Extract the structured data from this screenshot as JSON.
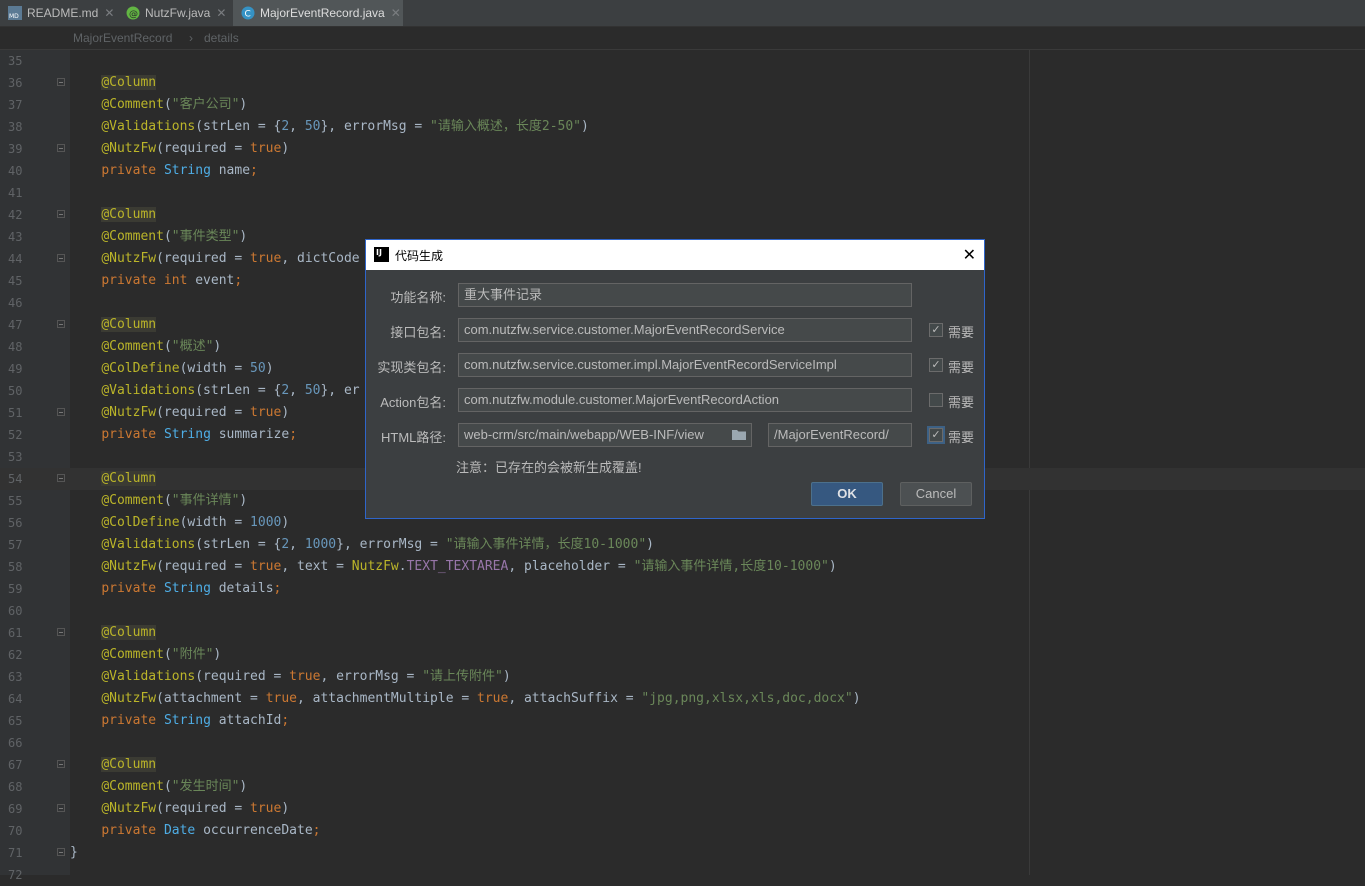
{
  "tabs": [
    {
      "label": "README.md",
      "icon": "markdown-file-icon",
      "active": false
    },
    {
      "label": "NutzFw.java",
      "icon": "annotation-file-icon",
      "active": false
    },
    {
      "label": "MajorEventRecord.java",
      "icon": "class-file-icon",
      "active": true
    }
  ],
  "breadcrumb": {
    "class_name": "MajorEventRecord",
    "member": "details"
  },
  "editor": {
    "lines": [
      {
        "n": "35",
        "fold": false,
        "tokens": []
      },
      {
        "n": "36",
        "fold": true,
        "tokens": [
          {
            "t": "    "
          },
          {
            "t": "@Column",
            "c": "ann hl"
          }
        ]
      },
      {
        "n": "37",
        "fold": false,
        "tokens": [
          {
            "t": "    "
          },
          {
            "t": "@Comment",
            "c": "ann"
          },
          {
            "t": "("
          },
          {
            "t": "\"客户公司\"",
            "c": "str"
          },
          {
            "t": ")"
          }
        ]
      },
      {
        "n": "38",
        "fold": false,
        "tokens": [
          {
            "t": "    "
          },
          {
            "t": "@Validations",
            "c": "ann"
          },
          {
            "t": "(strLen = {"
          },
          {
            "t": "2",
            "c": "num"
          },
          {
            "t": ", "
          },
          {
            "t": "50",
            "c": "num"
          },
          {
            "t": "}, errorMsg = "
          },
          {
            "t": "\"请输入概述，长度2-50\"",
            "c": "str"
          },
          {
            "t": ")"
          }
        ]
      },
      {
        "n": "39",
        "fold": true,
        "tokens": [
          {
            "t": "    "
          },
          {
            "t": "@NutzFw",
            "c": "ann"
          },
          {
            "t": "(required = "
          },
          {
            "t": "true",
            "c": "kw"
          },
          {
            "t": ")"
          }
        ]
      },
      {
        "n": "40",
        "fold": false,
        "tokens": [
          {
            "t": "    "
          },
          {
            "t": "private ",
            "c": "kw"
          },
          {
            "t": "String ",
            "c": "typ"
          },
          {
            "t": "name"
          },
          {
            "t": ";",
            "c": "kw"
          }
        ]
      },
      {
        "n": "41",
        "fold": false,
        "tokens": []
      },
      {
        "n": "42",
        "fold": true,
        "tokens": [
          {
            "t": "    "
          },
          {
            "t": "@Column",
            "c": "ann hl"
          }
        ]
      },
      {
        "n": "43",
        "fold": false,
        "tokens": [
          {
            "t": "    "
          },
          {
            "t": "@Comment",
            "c": "ann"
          },
          {
            "t": "("
          },
          {
            "t": "\"事件类型\"",
            "c": "str"
          },
          {
            "t": ")"
          }
        ]
      },
      {
        "n": "44",
        "fold": true,
        "tokens": [
          {
            "t": "    "
          },
          {
            "t": "@NutzFw",
            "c": "ann"
          },
          {
            "t": "(required = "
          },
          {
            "t": "true",
            "c": "kw"
          },
          {
            "t": ", dictCode"
          }
        ]
      },
      {
        "n": "45",
        "fold": false,
        "tokens": [
          {
            "t": "    "
          },
          {
            "t": "private int ",
            "c": "kw"
          },
          {
            "t": "event"
          },
          {
            "t": ";",
            "c": "kw"
          }
        ]
      },
      {
        "n": "46",
        "fold": false,
        "tokens": []
      },
      {
        "n": "47",
        "fold": true,
        "tokens": [
          {
            "t": "    "
          },
          {
            "t": "@Column",
            "c": "ann hl"
          }
        ]
      },
      {
        "n": "48",
        "fold": false,
        "tokens": [
          {
            "t": "    "
          },
          {
            "t": "@Comment",
            "c": "ann"
          },
          {
            "t": "("
          },
          {
            "t": "\"概述\"",
            "c": "str"
          },
          {
            "t": ")"
          }
        ]
      },
      {
        "n": "49",
        "fold": false,
        "tokens": [
          {
            "t": "    "
          },
          {
            "t": "@ColDefine",
            "c": "ann"
          },
          {
            "t": "(width = "
          },
          {
            "t": "50",
            "c": "num"
          },
          {
            "t": ")"
          }
        ]
      },
      {
        "n": "50",
        "fold": false,
        "tokens": [
          {
            "t": "    "
          },
          {
            "t": "@Validations",
            "c": "ann"
          },
          {
            "t": "(strLen = {"
          },
          {
            "t": "2",
            "c": "num"
          },
          {
            "t": ", "
          },
          {
            "t": "50",
            "c": "num"
          },
          {
            "t": "}, er"
          }
        ]
      },
      {
        "n": "51",
        "fold": true,
        "tokens": [
          {
            "t": "    "
          },
          {
            "t": "@NutzFw",
            "c": "ann"
          },
          {
            "t": "(required = "
          },
          {
            "t": "true",
            "c": "kw"
          },
          {
            "t": ")"
          }
        ]
      },
      {
        "n": "52",
        "fold": false,
        "tokens": [
          {
            "t": "    "
          },
          {
            "t": "private ",
            "c": "kw"
          },
          {
            "t": "String ",
            "c": "typ"
          },
          {
            "t": "summarize"
          },
          {
            "t": ";",
            "c": "kw"
          }
        ]
      },
      {
        "n": "53",
        "fold": false,
        "tokens": []
      },
      {
        "n": "54",
        "fold": true,
        "cur": true,
        "tokens": [
          {
            "t": "    "
          },
          {
            "t": "@Column",
            "c": "ann hl"
          }
        ]
      },
      {
        "n": "55",
        "fold": false,
        "tokens": [
          {
            "t": "    "
          },
          {
            "t": "@Comment",
            "c": "ann"
          },
          {
            "t": "("
          },
          {
            "t": "\"事件详情\"",
            "c": "str"
          },
          {
            "t": ")"
          }
        ]
      },
      {
        "n": "56",
        "fold": false,
        "tokens": [
          {
            "t": "    "
          },
          {
            "t": "@ColDefine",
            "c": "ann"
          },
          {
            "t": "(width = "
          },
          {
            "t": "1000",
            "c": "num"
          },
          {
            "t": ")"
          }
        ]
      },
      {
        "n": "57",
        "fold": false,
        "tokens": [
          {
            "t": "    "
          },
          {
            "t": "@Validations",
            "c": "ann"
          },
          {
            "t": "(strLen = {"
          },
          {
            "t": "2",
            "c": "num"
          },
          {
            "t": ", "
          },
          {
            "t": "1000",
            "c": "num"
          },
          {
            "t": "}, errorMsg = "
          },
          {
            "t": "\"请输入事件详情，长度10-1000\"",
            "c": "str"
          },
          {
            "t": ")"
          }
        ]
      },
      {
        "n": "58",
        "fold": false,
        "tokens": [
          {
            "t": "    "
          },
          {
            "t": "@NutzFw",
            "c": "ann"
          },
          {
            "t": "(required = "
          },
          {
            "t": "true",
            "c": "kw"
          },
          {
            "t": ", text = "
          },
          {
            "t": "NutzFw",
            "c": "ann"
          },
          {
            "t": "."
          },
          {
            "t": "TEXT_TEXTAREA",
            "c": "fld"
          },
          {
            "t": ", placeholder = "
          },
          {
            "t": "\"请输入事件详情,长度10-1000\"",
            "c": "str"
          },
          {
            "t": ")"
          }
        ]
      },
      {
        "n": "59",
        "fold": false,
        "tokens": [
          {
            "t": "    "
          },
          {
            "t": "private ",
            "c": "kw"
          },
          {
            "t": "String ",
            "c": "typ"
          },
          {
            "t": "details"
          },
          {
            "t": ";",
            "c": "kw"
          }
        ]
      },
      {
        "n": "60",
        "fold": false,
        "tokens": []
      },
      {
        "n": "61",
        "fold": true,
        "tokens": [
          {
            "t": "    "
          },
          {
            "t": "@Column",
            "c": "ann hl"
          }
        ]
      },
      {
        "n": "62",
        "fold": false,
        "tokens": [
          {
            "t": "    "
          },
          {
            "t": "@Comment",
            "c": "ann"
          },
          {
            "t": "("
          },
          {
            "t": "\"附件\"",
            "c": "str"
          },
          {
            "t": ")"
          }
        ]
      },
      {
        "n": "63",
        "fold": false,
        "tokens": [
          {
            "t": "    "
          },
          {
            "t": "@Validations",
            "c": "ann"
          },
          {
            "t": "(required = "
          },
          {
            "t": "true",
            "c": "kw"
          },
          {
            "t": ", errorMsg = "
          },
          {
            "t": "\"请上传附件\"",
            "c": "str"
          },
          {
            "t": ")"
          }
        ]
      },
      {
        "n": "64",
        "fold": false,
        "tokens": [
          {
            "t": "    "
          },
          {
            "t": "@NutzFw",
            "c": "ann"
          },
          {
            "t": "(attachment = "
          },
          {
            "t": "true",
            "c": "kw"
          },
          {
            "t": ", attachmentMultiple = "
          },
          {
            "t": "true",
            "c": "kw"
          },
          {
            "t": ", attachSuffix = "
          },
          {
            "t": "\"jpg,png,xlsx,xls,doc,docx\"",
            "c": "str"
          },
          {
            "t": ")"
          }
        ]
      },
      {
        "n": "65",
        "fold": false,
        "tokens": [
          {
            "t": "    "
          },
          {
            "t": "private ",
            "c": "kw"
          },
          {
            "t": "String ",
            "c": "typ"
          },
          {
            "t": "attachId"
          },
          {
            "t": ";",
            "c": "kw"
          }
        ]
      },
      {
        "n": "66",
        "fold": false,
        "tokens": []
      },
      {
        "n": "67",
        "fold": true,
        "tokens": [
          {
            "t": "    "
          },
          {
            "t": "@Column",
            "c": "ann hl"
          }
        ]
      },
      {
        "n": "68",
        "fold": false,
        "tokens": [
          {
            "t": "    "
          },
          {
            "t": "@Comment",
            "c": "ann"
          },
          {
            "t": "("
          },
          {
            "t": "\"发生时间\"",
            "c": "str"
          },
          {
            "t": ")"
          }
        ]
      },
      {
        "n": "69",
        "fold": true,
        "tokens": [
          {
            "t": "    "
          },
          {
            "t": "@NutzFw",
            "c": "ann"
          },
          {
            "t": "(required = "
          },
          {
            "t": "true",
            "c": "kw"
          },
          {
            "t": ")"
          }
        ]
      },
      {
        "n": "70",
        "fold": false,
        "tokens": [
          {
            "t": "    "
          },
          {
            "t": "private ",
            "c": "kw"
          },
          {
            "t": "Date ",
            "c": "typ"
          },
          {
            "t": "occurrenceDate"
          },
          {
            "t": ";",
            "c": "kw"
          }
        ]
      },
      {
        "n": "71",
        "fold": true,
        "tokens": [
          {
            "t": "}"
          }
        ]
      },
      {
        "n": "72",
        "fold": false,
        "tokens": []
      }
    ]
  },
  "dialog": {
    "title": "代码生成",
    "func_label": "功能名称:",
    "func_value": "重大事件记录",
    "iface_label": "接口包名:",
    "iface_value": "com.nutzfw.service.customer.MajorEventRecordService",
    "iface_checked": true,
    "impl_label": "实现类包名:",
    "impl_value": "com.nutzfw.service.customer.impl.MajorEventRecordServiceImpl",
    "impl_checked": true,
    "action_label": "Action包名:",
    "action_value": "com.nutzfw.module.customer.MajorEventRecordAction",
    "action_checked": false,
    "html_label": "HTML路径:",
    "html_value": "web-crm/src/main/webapp/WEB-INF/view",
    "html_sub_value": "/MajorEventRecord/",
    "html_checked": true,
    "need_label": "需要",
    "note": "注意：已存在的会被新生成覆盖!",
    "ok_label": "OK",
    "cancel_label": "Cancel"
  }
}
